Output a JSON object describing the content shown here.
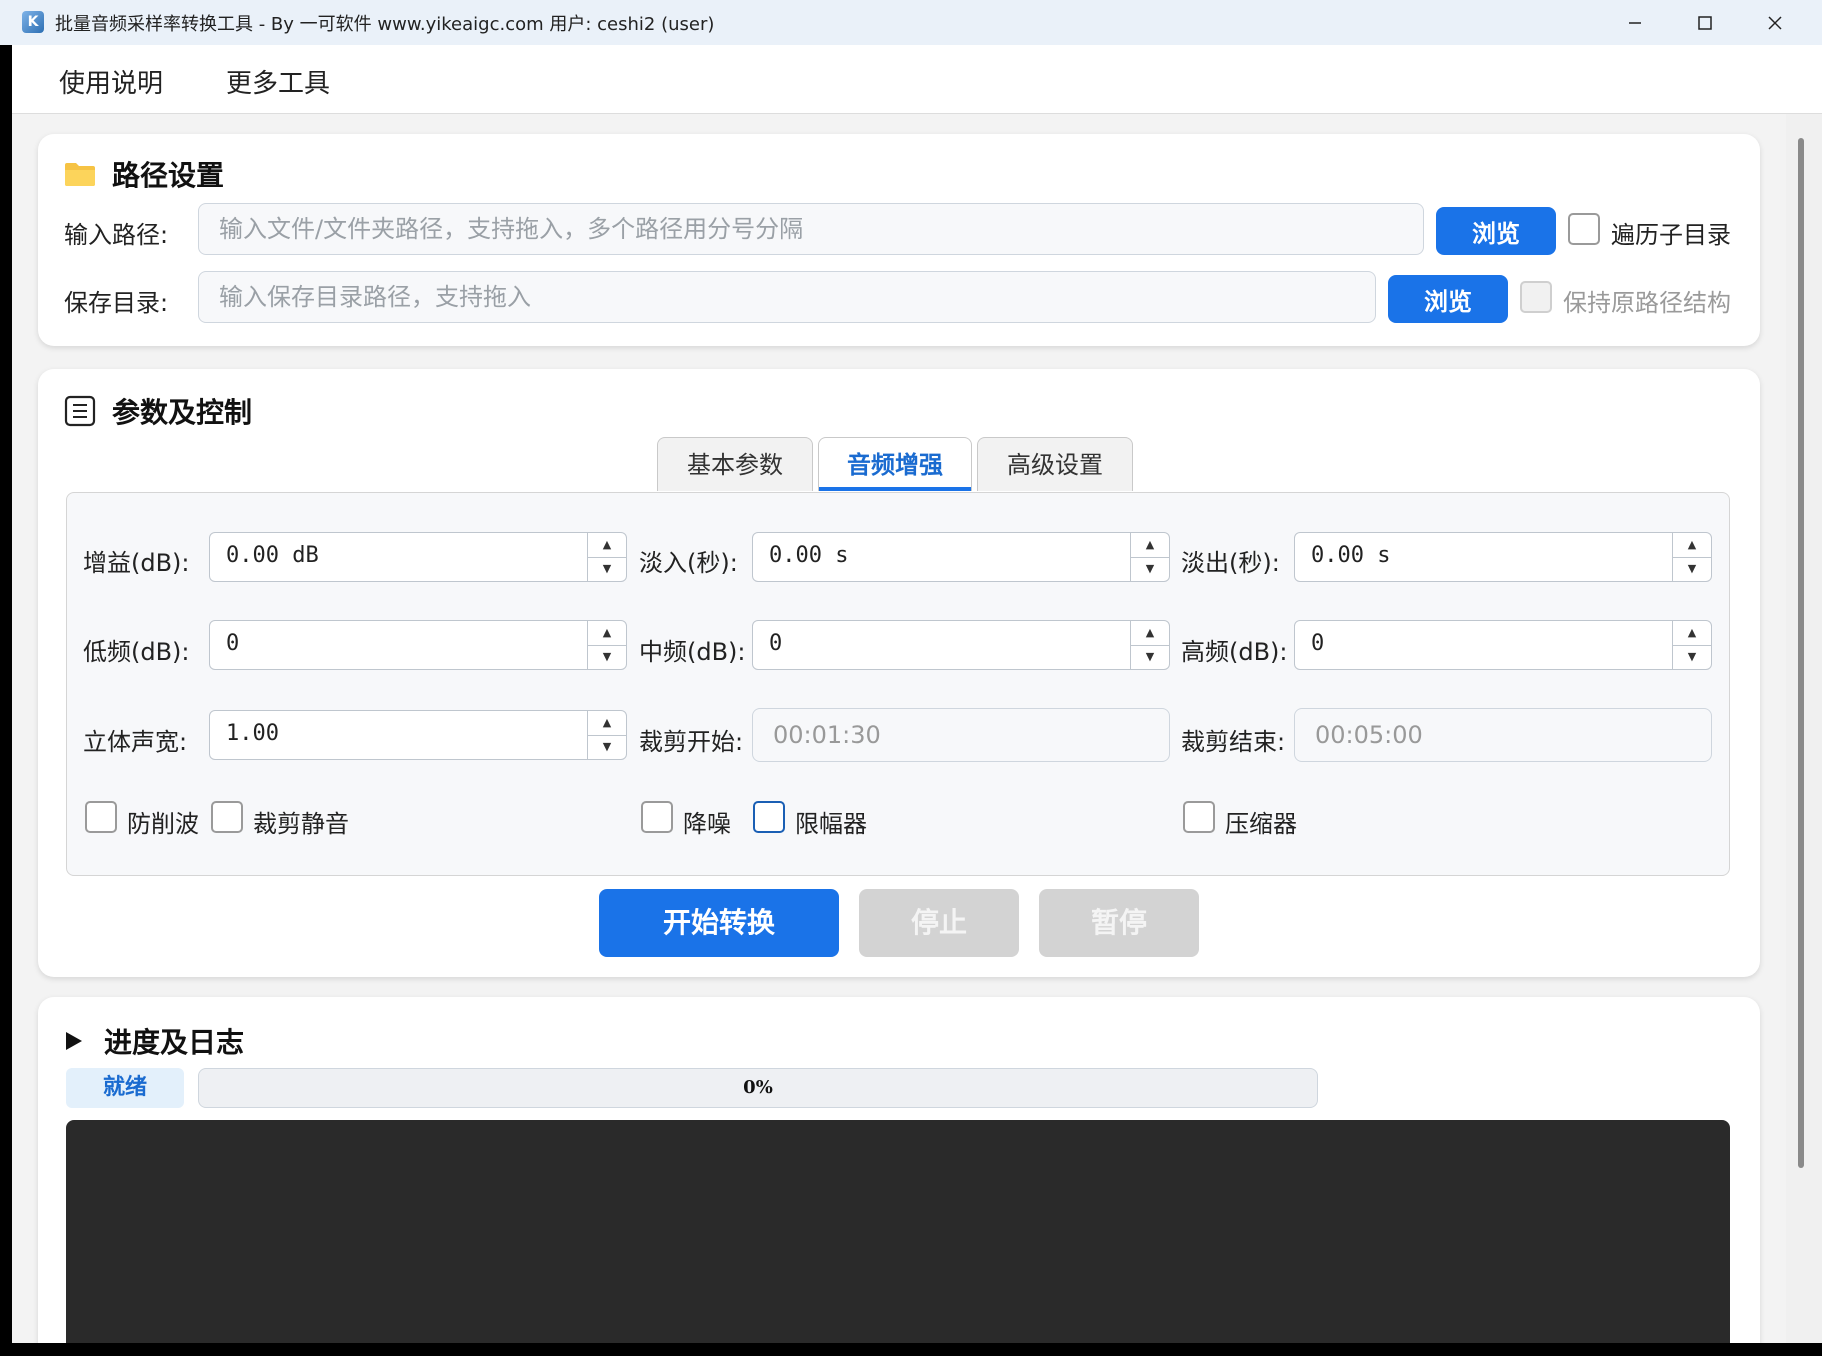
{
  "window": {
    "title": "批量音频采样率转换工具 - By 一可软件 www.yikeaigc.com 用户: ceshi2 (user)"
  },
  "menu": {
    "items": [
      "使用说明",
      "更多工具"
    ]
  },
  "path_section": {
    "title": "路径设置",
    "input_label": "输入路径:",
    "input_placeholder": "输入文件/文件夹路径，支持拖入，多个路径用分号分隔",
    "input_value": "",
    "browse_label": "浏览",
    "recurse_label": "遍历子目录",
    "recurse_checked": false,
    "save_label": "保存目录:",
    "save_placeholder": "输入保存目录路径，支持拖入",
    "save_value": "",
    "save_browse_label": "浏览",
    "keep_structure_label": "保持原路径结构",
    "keep_structure_checked": false
  },
  "params_section": {
    "title": "参数及控制",
    "tabs": [
      {
        "label": "基本参数",
        "active": false
      },
      {
        "label": "音频增强",
        "active": true
      },
      {
        "label": "高级设置",
        "active": false
      }
    ],
    "fields": {
      "gain": {
        "label": "增益(dB):",
        "value": "0.00 dB"
      },
      "fade_in": {
        "label": "淡入(秒):",
        "value": "0.00 s"
      },
      "fade_out": {
        "label": "淡出(秒):",
        "value": "0.00 s"
      },
      "low": {
        "label": "低频(dB):",
        "value": "0"
      },
      "mid": {
        "label": "中频(dB):",
        "value": "0"
      },
      "high": {
        "label": "高频(dB):",
        "value": "0"
      },
      "stereo": {
        "label": "立体声宽:",
        "value": "1.00"
      },
      "trim_start": {
        "label": "裁剪开始:",
        "placeholder": "00:01:30"
      },
      "trim_end": {
        "label": "裁剪结束:",
        "placeholder": "00:05:00"
      }
    },
    "checkboxes": {
      "anticlip": {
        "label": "防削波",
        "checked": false
      },
      "trim_silence": {
        "label": "裁剪静音",
        "checked": false
      },
      "denoise": {
        "label": "降噪",
        "checked": false
      },
      "limiter": {
        "label": "限幅器",
        "checked": false
      },
      "compressor": {
        "label": "压缩器",
        "checked": false
      }
    },
    "buttons": {
      "start": "开始转换",
      "stop": "停止",
      "pause": "暂停"
    }
  },
  "progress_section": {
    "title": "进度及日志",
    "status": "就绪",
    "progress_text": "0%",
    "progress_value": 0
  },
  "colors": {
    "accent": "#1a73e8",
    "disabled_button": "#d3d3d3",
    "log_background": "#2a2a2a"
  }
}
